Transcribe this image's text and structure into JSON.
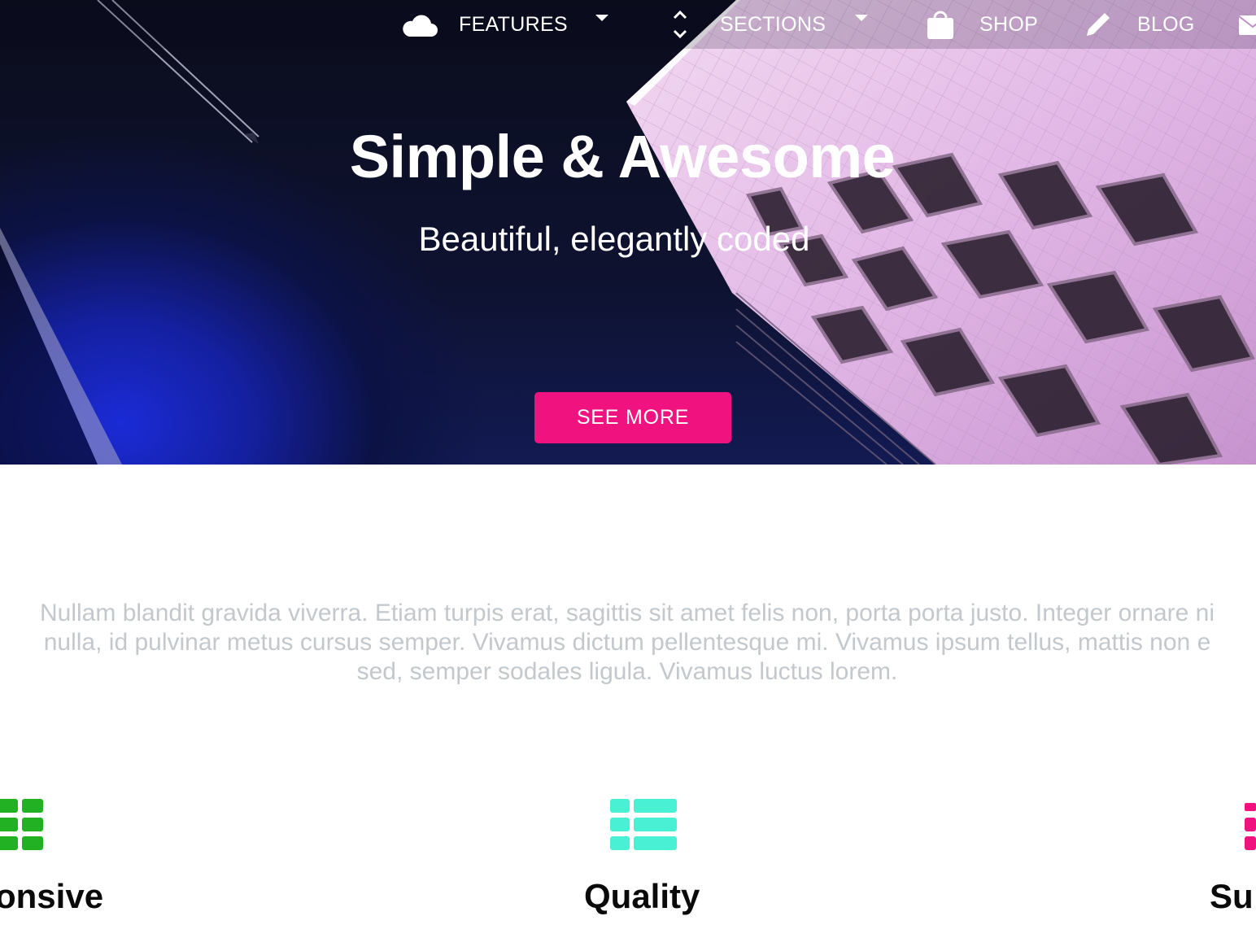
{
  "nav": {
    "items": [
      {
        "label": "FEATURES",
        "icon": "cloud-icon",
        "has_dropdown": true
      },
      {
        "label": "SECTIONS",
        "icon": "unfold-icon",
        "has_dropdown": true
      },
      {
        "label": "SHOP",
        "icon": "shopping-bag-icon",
        "has_dropdown": false
      },
      {
        "label": "BLOG",
        "icon": "pencil-icon",
        "has_dropdown": false
      },
      {
        "label": "",
        "icon": "envelope-icon",
        "has_dropdown": false
      }
    ]
  },
  "hero": {
    "title": "Simple & Awesome",
    "subtitle": "Beautiful, elegantly coded",
    "cta_label": "SEE MORE"
  },
  "intro": {
    "lines": [
      "Nullam blandit gravida viverra. Etiam turpis erat, sagittis sit amet felis non, porta porta justo. Integer ornare ni",
      "nulla, id pulvinar metus cursus semper. Vivamus dictum pellentesque mi. Vivamus ipsum tellus, mattis non e",
      "sed, semper sodales ligula. Vivamus luctus lorem."
    ]
  },
  "features": [
    {
      "title": "onsive",
      "icon": "grid-icon",
      "color": "#22b122"
    },
    {
      "title": "Quality",
      "icon": "list-icon",
      "color": "#4af0d4"
    },
    {
      "title": "Su",
      "icon": "list-icon",
      "color": "#f0137f"
    }
  ],
  "colors": {
    "accent": "#f0137f",
    "intro_text": "#c3c8cd",
    "hero_blue": "#1b2bd6",
    "building_pink": "#e8c4ea"
  }
}
